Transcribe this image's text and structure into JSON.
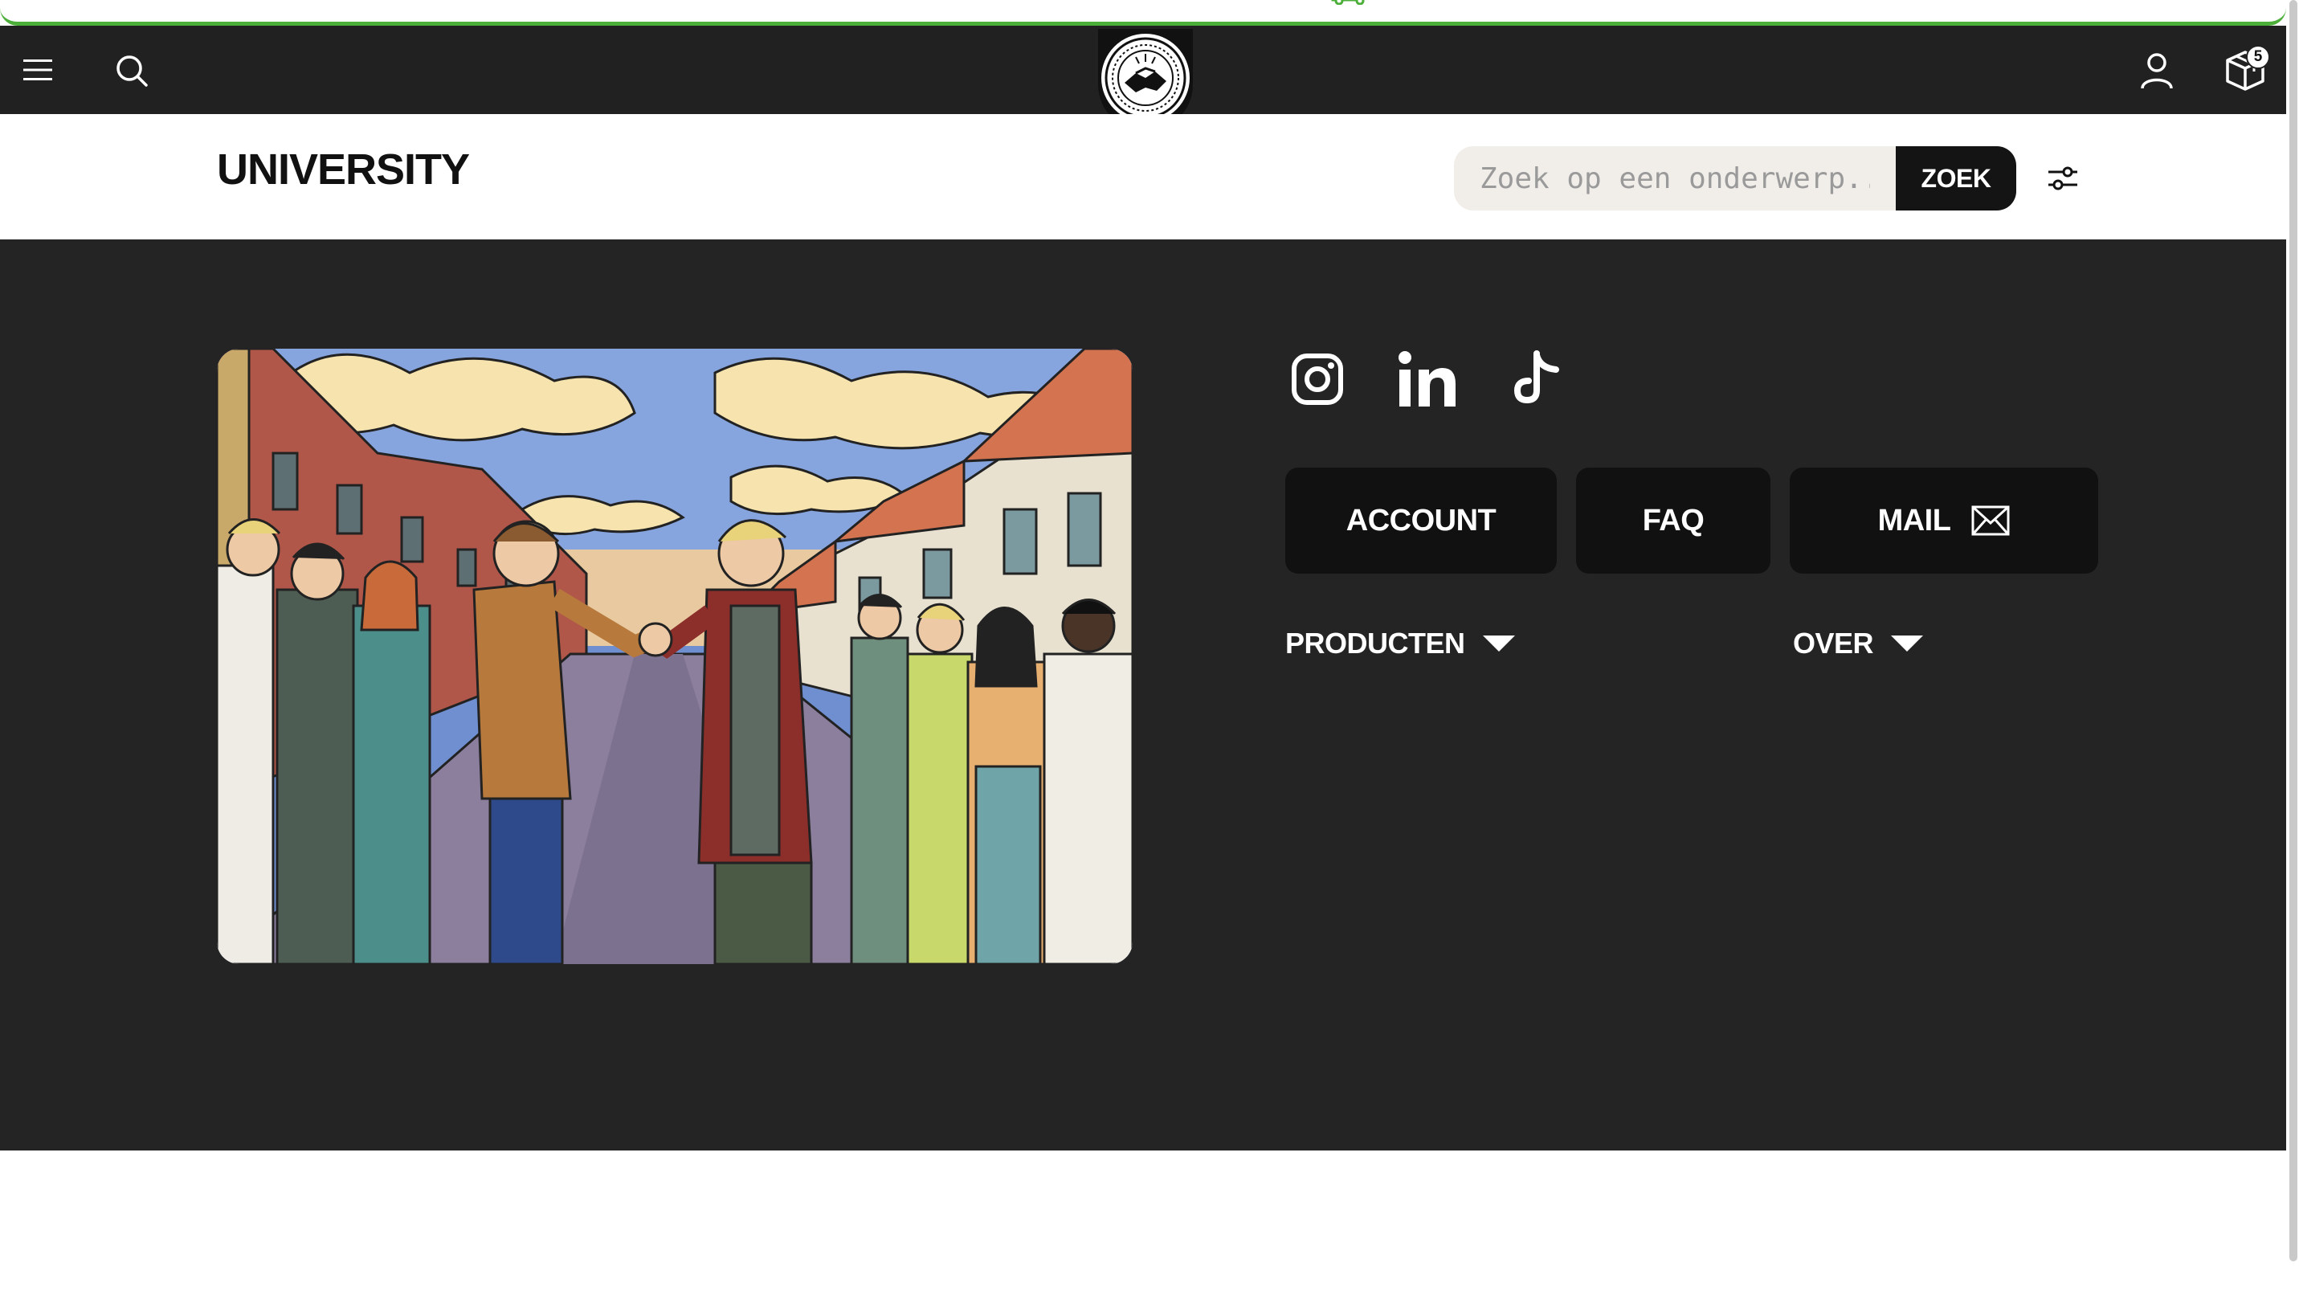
{
  "header": {
    "menu_icon": "hamburger-menu-icon",
    "search_icon": "search-icon",
    "logo": "handshake-emblem-logo",
    "account_icon": "user-icon",
    "cart_icon": "box-icon",
    "cart_count": "5"
  },
  "titlebar": {
    "title": "UNIVERSITY",
    "search_placeholder": "Zoek op een onderwerp...",
    "search_button": "ZOEK",
    "filter_icon": "sliders-icon"
  },
  "content": {
    "hero_image": "illustration-two-men-handshake-on-street-with-crowd",
    "socials": [
      "instagram-icon",
      "linkedin-icon",
      "tiktok-icon"
    ],
    "buttons": {
      "account": "ACCOUNT",
      "faq": "FAQ",
      "mail": "MAIL"
    },
    "dropdowns": {
      "products": "PRODUCTEN",
      "over": "OVER"
    }
  },
  "colors": {
    "header_bg": "#212121",
    "content_bg": "#242424",
    "button_bg": "#111111",
    "accent_green": "#4caf3a",
    "search_bg": "#f1eeea"
  }
}
